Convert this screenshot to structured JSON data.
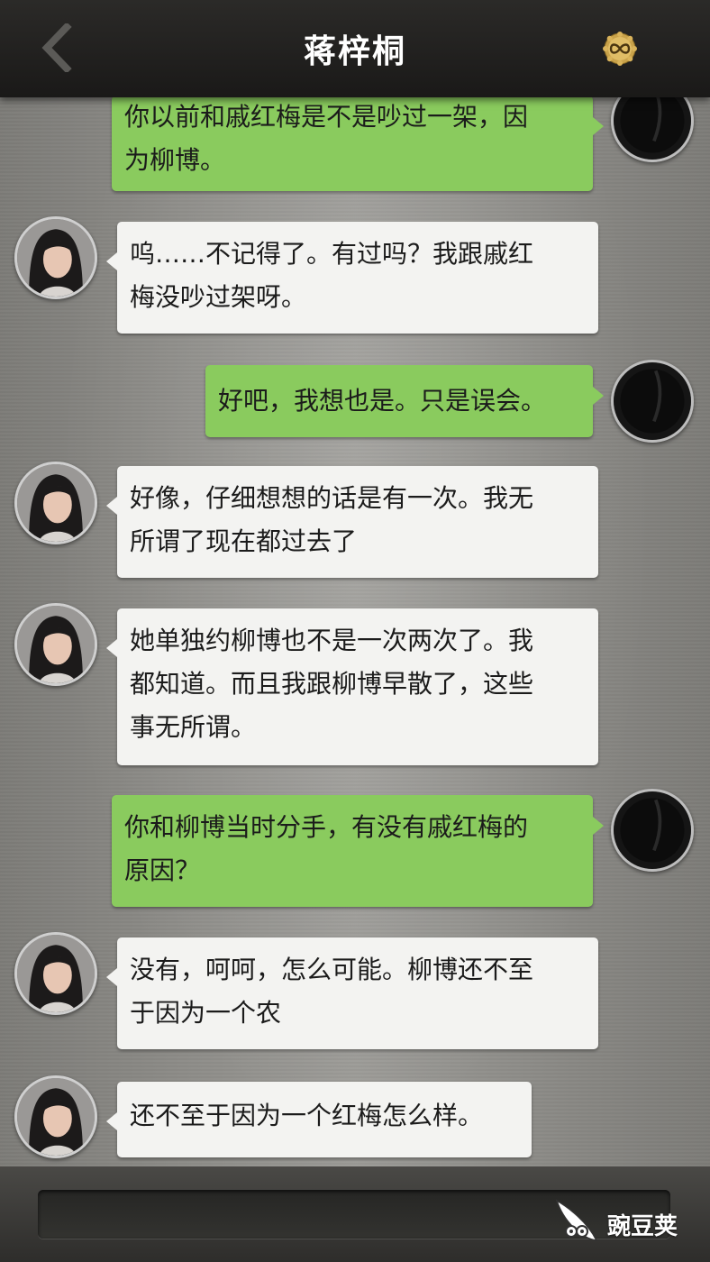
{
  "header": {
    "back_icon": "chevron-left-icon",
    "title": "蒋梓桐",
    "menu_icon": "infinity-badge-icon"
  },
  "messages": [
    {
      "from": "me",
      "lines": [
        "你以前和戚红梅是不是吵过一架，因",
        "为柳博。"
      ]
    },
    {
      "from": "contact",
      "lines": [
        "呜……不记得了。有过吗？我跟戚红",
        "梅没吵过架呀。"
      ]
    },
    {
      "from": "me",
      "lines": [
        "好吧，我想也是。只是误会。"
      ]
    },
    {
      "from": "contact",
      "lines": [
        "好像，仔细想想的话是有一次。我无",
        "所谓了现在都过去了"
      ]
    },
    {
      "from": "contact",
      "lines": [
        "她单独约柳博也不是一次两次了。我",
        "都知道。而且我跟柳博早散了，这些",
        "事无所谓。"
      ]
    },
    {
      "from": "me",
      "lines": [
        "你和柳博当时分手，有没有戚红梅的",
        "原因？"
      ]
    },
    {
      "from": "contact",
      "lines": [
        "没有，呵呵，怎么可能。柳博还不至",
        "于因为一个农"
      ]
    },
    {
      "from": "contact",
      "lines": [
        "还不至于因为一个红梅怎么样。"
      ]
    }
  ],
  "input": {
    "placeholder": ""
  },
  "watermark": {
    "text": "豌豆荚",
    "icon": "pea-pod-logo-icon"
  },
  "colors": {
    "me_bubble": "#8acb5e",
    "contact_bubble": "#f3f3f1",
    "header": "#222120"
  }
}
